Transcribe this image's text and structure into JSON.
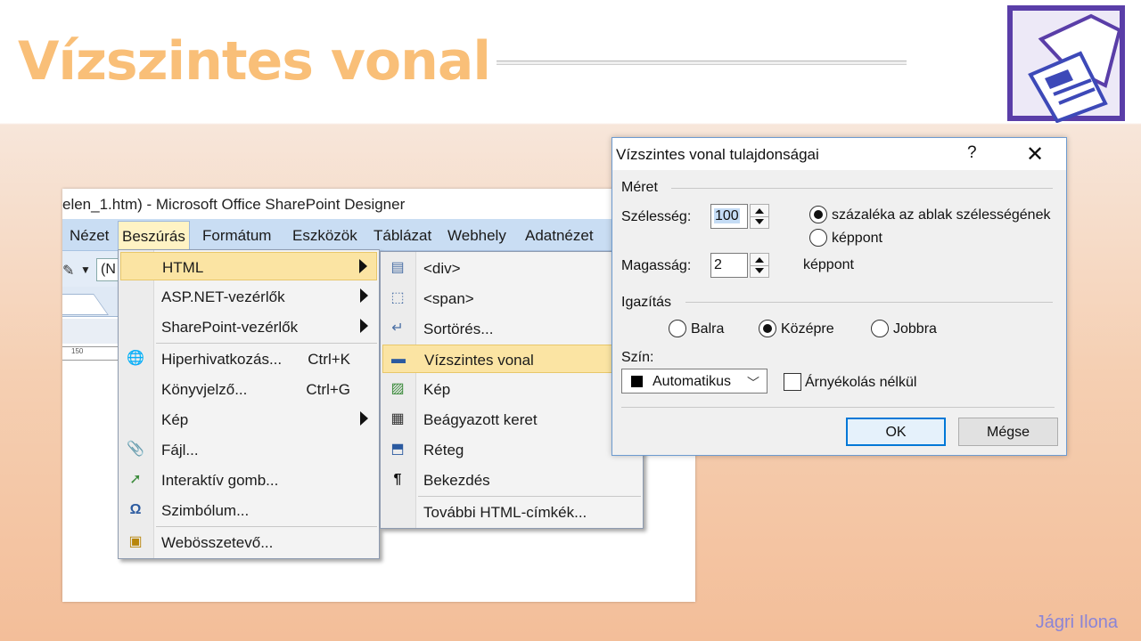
{
  "slide": {
    "title": "Vízszintes vonal",
    "author": "Jágri Ilona"
  },
  "app_window": {
    "title": "elen_1.htm) - Microsoft Office SharePoint Designer",
    "menubar": [
      "Nézet",
      "Beszúrás",
      "Formátum",
      "Eszközök",
      "Táblázat",
      "Webhely",
      "Adatnézet"
    ],
    "toolbar_box_text": "(N",
    "ruler_label": "150"
  },
  "insert_menu": {
    "items": [
      {
        "label": "HTML",
        "icon": "none",
        "submenu": true,
        "highlighted": true
      },
      {
        "label": "ASP.NET-vezérlők",
        "icon": "none",
        "submenu": true
      },
      {
        "label": "SharePoint-vezérlők",
        "icon": "none",
        "submenu": true
      },
      {
        "label": "Hiperhivatkozás...",
        "shortcut": "Ctrl+K",
        "icon": "globe-link-icon"
      },
      {
        "label": "Könyvjelző...",
        "shortcut": "Ctrl+G",
        "icon": "none"
      },
      {
        "label": "Kép",
        "icon": "none",
        "submenu": true
      },
      {
        "label": "Fájl...",
        "icon": "paperclip-icon"
      },
      {
        "label": "Interaktív gomb...",
        "icon": "interactive-button-icon"
      },
      {
        "label": "Szimbólum...",
        "icon": "omega-icon"
      },
      {
        "label": "Webösszetevő...",
        "icon": "web-component-icon"
      }
    ]
  },
  "html_submenu": {
    "items": [
      {
        "label": "<div>",
        "icon": "div-icon"
      },
      {
        "label": "<span>",
        "icon": "span-icon"
      },
      {
        "label": "Sortörés...",
        "icon": "line-break-icon"
      },
      {
        "label": "Vízszintes vonal",
        "icon": "horizontal-line-icon",
        "highlighted": true
      },
      {
        "label": "Kép",
        "icon": "picture-icon"
      },
      {
        "label": "Beágyazott keret",
        "icon": "inline-frame-icon"
      },
      {
        "label": "Réteg",
        "icon": "layer-icon"
      },
      {
        "label": "Bekezdés",
        "icon": "pilcrow-icon"
      },
      {
        "label": "További HTML-címkék...",
        "icon": "none"
      }
    ]
  },
  "dialog": {
    "title": "Vízszintes vonal tulajdonságai",
    "help": "?",
    "size_group": "Méret",
    "width_label": "Szélesség:",
    "width_value": "100",
    "width_unit_percent": "százaléka az ablak szélességének",
    "width_unit_pixels": "képpont",
    "height_label": "Magasság:",
    "height_value": "2",
    "height_unit": "képpont",
    "align_group": "Igazítás",
    "align_options": [
      "Balra",
      "Középre",
      "Jobbra"
    ],
    "align_selected": "Középre",
    "color_label": "Szín:",
    "color_value": "Automatikus",
    "color_swatch": "#000000",
    "no_shade_label": "Árnyékolás nélkül",
    "no_shade_checked": false,
    "ok": "OK",
    "cancel": "Mégse"
  },
  "colors": {
    "title": "#f9bf78",
    "author": "#8a84d6",
    "menu_highlight": "#fbe4a3",
    "menubar": "#c9ddf3"
  }
}
